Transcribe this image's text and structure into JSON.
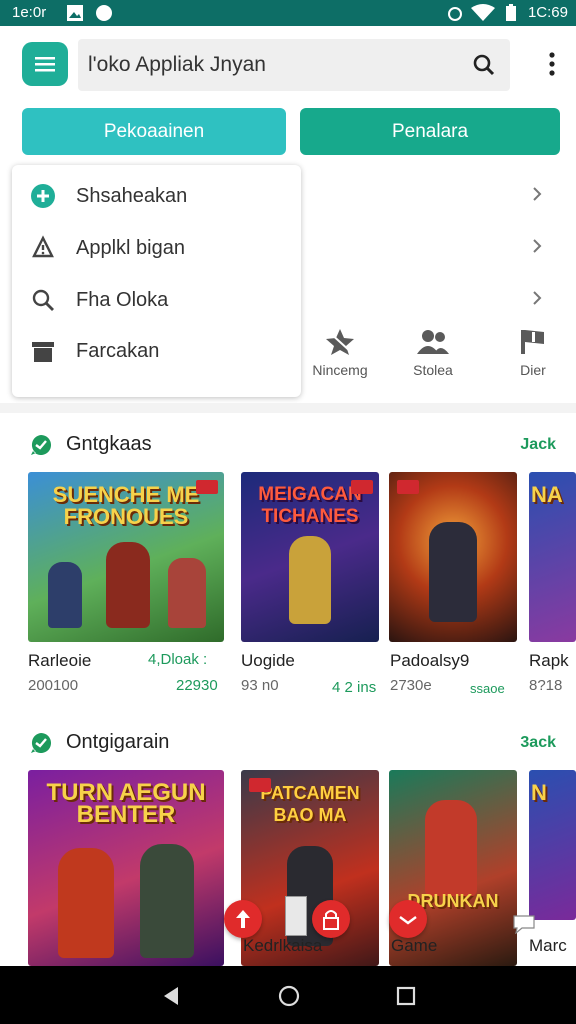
{
  "status": {
    "time": "1e:0r",
    "battery": "1C:69"
  },
  "search": {
    "value": "l'oko Appliak Jnyan"
  },
  "buttons": {
    "primary": "Pekoaainen",
    "secondary": "Penalara"
  },
  "menu": {
    "items": [
      {
        "label": "Shsaheakan",
        "icon": "plus-circle-icon"
      },
      {
        "label": "Applkl bigan",
        "icon": "bell-icon"
      },
      {
        "label": "Fha Oloka",
        "icon": "search-icon"
      },
      {
        "label": "Farcakan",
        "icon": "trash-icon"
      }
    ]
  },
  "quick_actions": [
    {
      "label": "Nincemg",
      "icon": "star-icon"
    },
    {
      "label": "Stolea",
      "icon": "people-icon"
    },
    {
      "label": "Dier",
      "icon": "flag-icon"
    }
  ],
  "sections": [
    {
      "title": "Gntgkaas",
      "more": "Jack",
      "games": [
        {
          "art_title": "SUENCHE ME FRONOUES",
          "title": "Rarleoie",
          "subtitle": "200100",
          "price": "4,Dloak :",
          "price2": "22930"
        },
        {
          "art_title": "MEIGACAN TICHANES",
          "title": "Uogide",
          "subtitle": "93 n0",
          "price": "4 2 ins"
        },
        {
          "art_title": "",
          "title": "Padoalsy9",
          "subtitle": "2730e",
          "price": "ssaoe"
        },
        {
          "art_title": "NA",
          "title": "Rapk",
          "subtitle": "8?18"
        }
      ]
    },
    {
      "title": "Ontgigarain",
      "more": "3ack",
      "games": [
        {
          "art_title": "TURN AEGUN BENTER",
          "title": "Kedrlkaisa"
        },
        {
          "art_title": "PATCAMEN BAO MA",
          "title": ""
        },
        {
          "art_title": "DRUNKAN",
          "title": "Game"
        },
        {
          "art_title": "N",
          "title": "Marc"
        }
      ]
    }
  ],
  "colors": {
    "accent": "#1fae98",
    "status_bar": "#0d6e66",
    "primary_button": "#2fc1c1",
    "secondary_button": "#17a98c",
    "link_green": "#1d9a5c",
    "fab_red": "#e02b2b"
  }
}
